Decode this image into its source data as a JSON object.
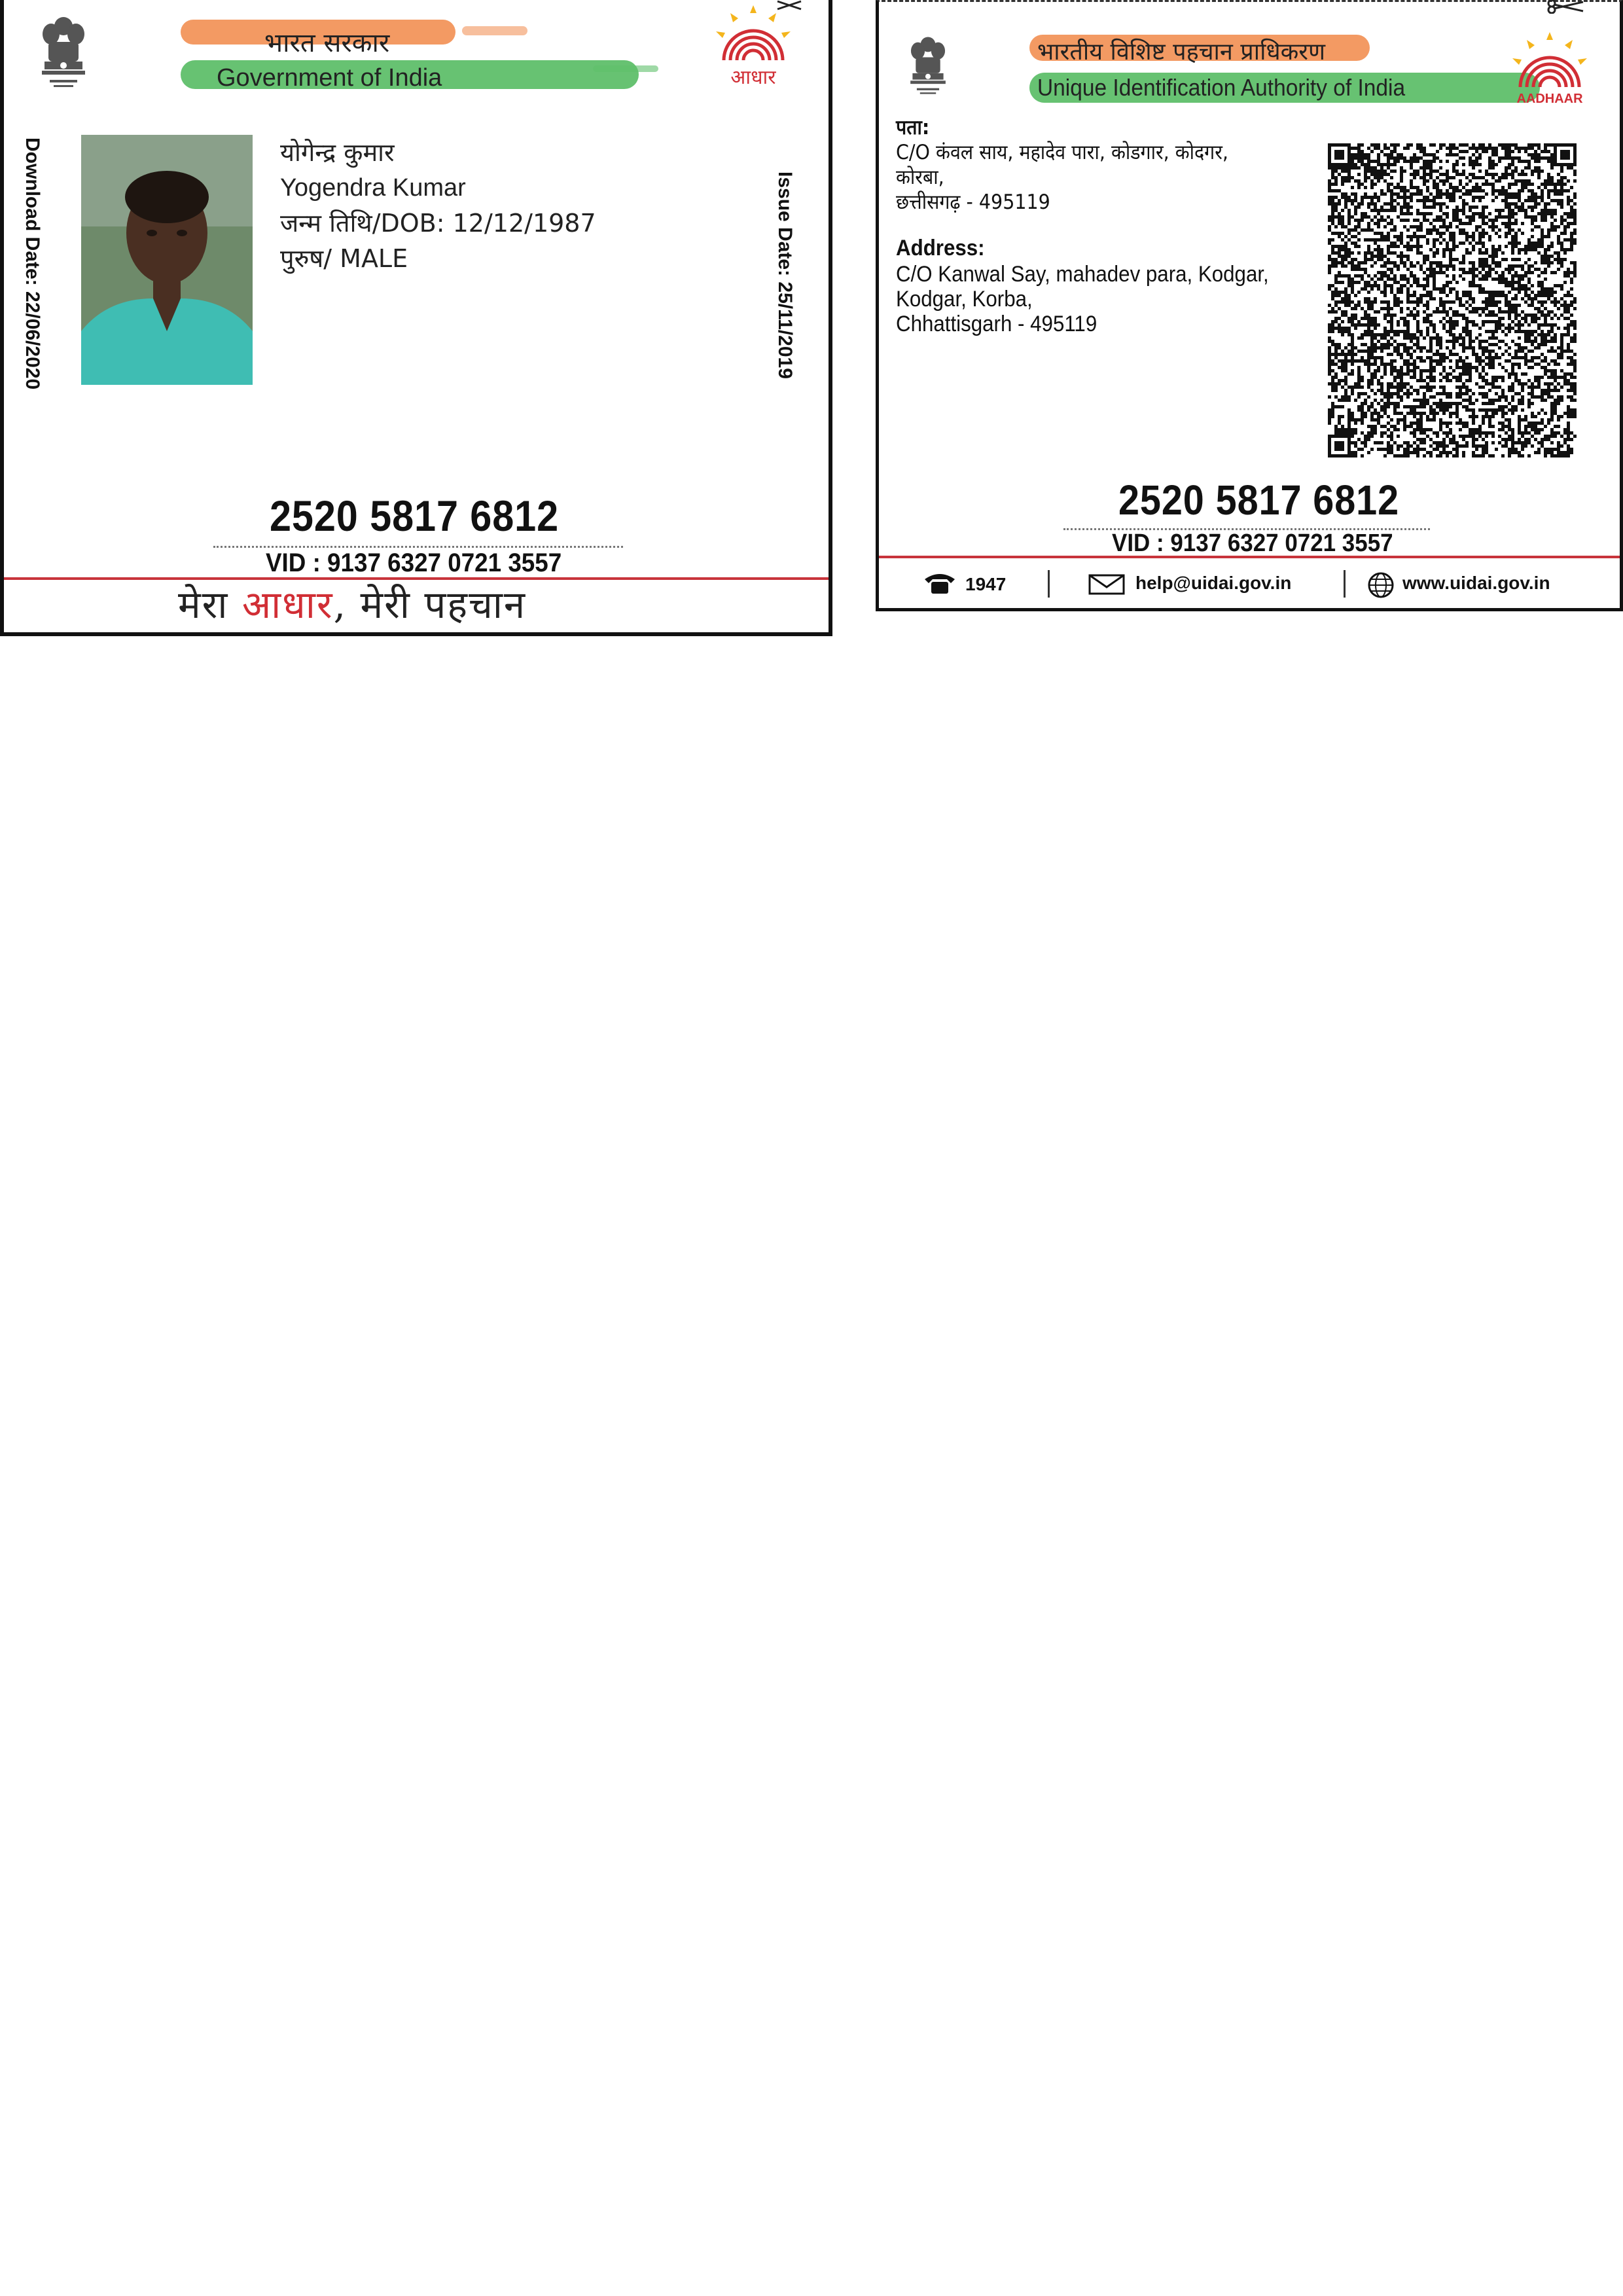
{
  "front": {
    "header_hindi": "भारत सरकार",
    "header_english": "Government of India",
    "logo_text": "आधार",
    "name_hindi": "योगेन्द्र कुमार",
    "name_english": "Yogendra Kumar",
    "dob_line": "जन्म तिथि/DOB: 12/12/1987",
    "gender_line": "पुरुष/ MALE",
    "download_date": "Download Date: 22/06/2020",
    "issue_date": "Issue Date: 25/11/2019",
    "aadhaar_number": "2520 5817 6812",
    "vid": "VID : 9137 6327 0721 3557",
    "slogan_1": "मेरा ",
    "slogan_2": "आधार",
    "slogan_3": ", मेरी पहचान",
    "colors": {
      "saffron": "#f2955b",
      "green": "#5fbf6a",
      "red": "#d12e35"
    }
  },
  "back": {
    "header_hindi": "भारतीय विशिष्ट पहचान प्राधिकरण",
    "header_english": "Unique Identification Authority of India",
    "logo_text": "AADHAAR",
    "address_label_hindi": "पता:",
    "address_hindi_1": "C/O कंवल साय, महादेव पारा, कोडगार, कोदगर,",
    "address_hindi_2": "कोरबा,",
    "address_hindi_3": "छत्तीसगढ़ - 495119",
    "address_label_english": "Address:",
    "address_english_1": "C/O Kanwal Say, mahadev para, Kodgar,",
    "address_english_2": "Kodgar, Korba,",
    "address_english_3": "Chhattisgarh - 495119",
    "aadhaar_number": "2520 5817 6812",
    "vid": "VID : 9137 6327 0721 3557",
    "phone": "1947",
    "email": "help@uidai.gov.in",
    "website": "www.uidai.gov.in",
    "icons": [
      "phone-icon",
      "mail-icon",
      "globe-icon",
      "qr-code-icon",
      "emblem-icon",
      "aadhaar-logo-icon",
      "scissors-icon"
    ]
  }
}
